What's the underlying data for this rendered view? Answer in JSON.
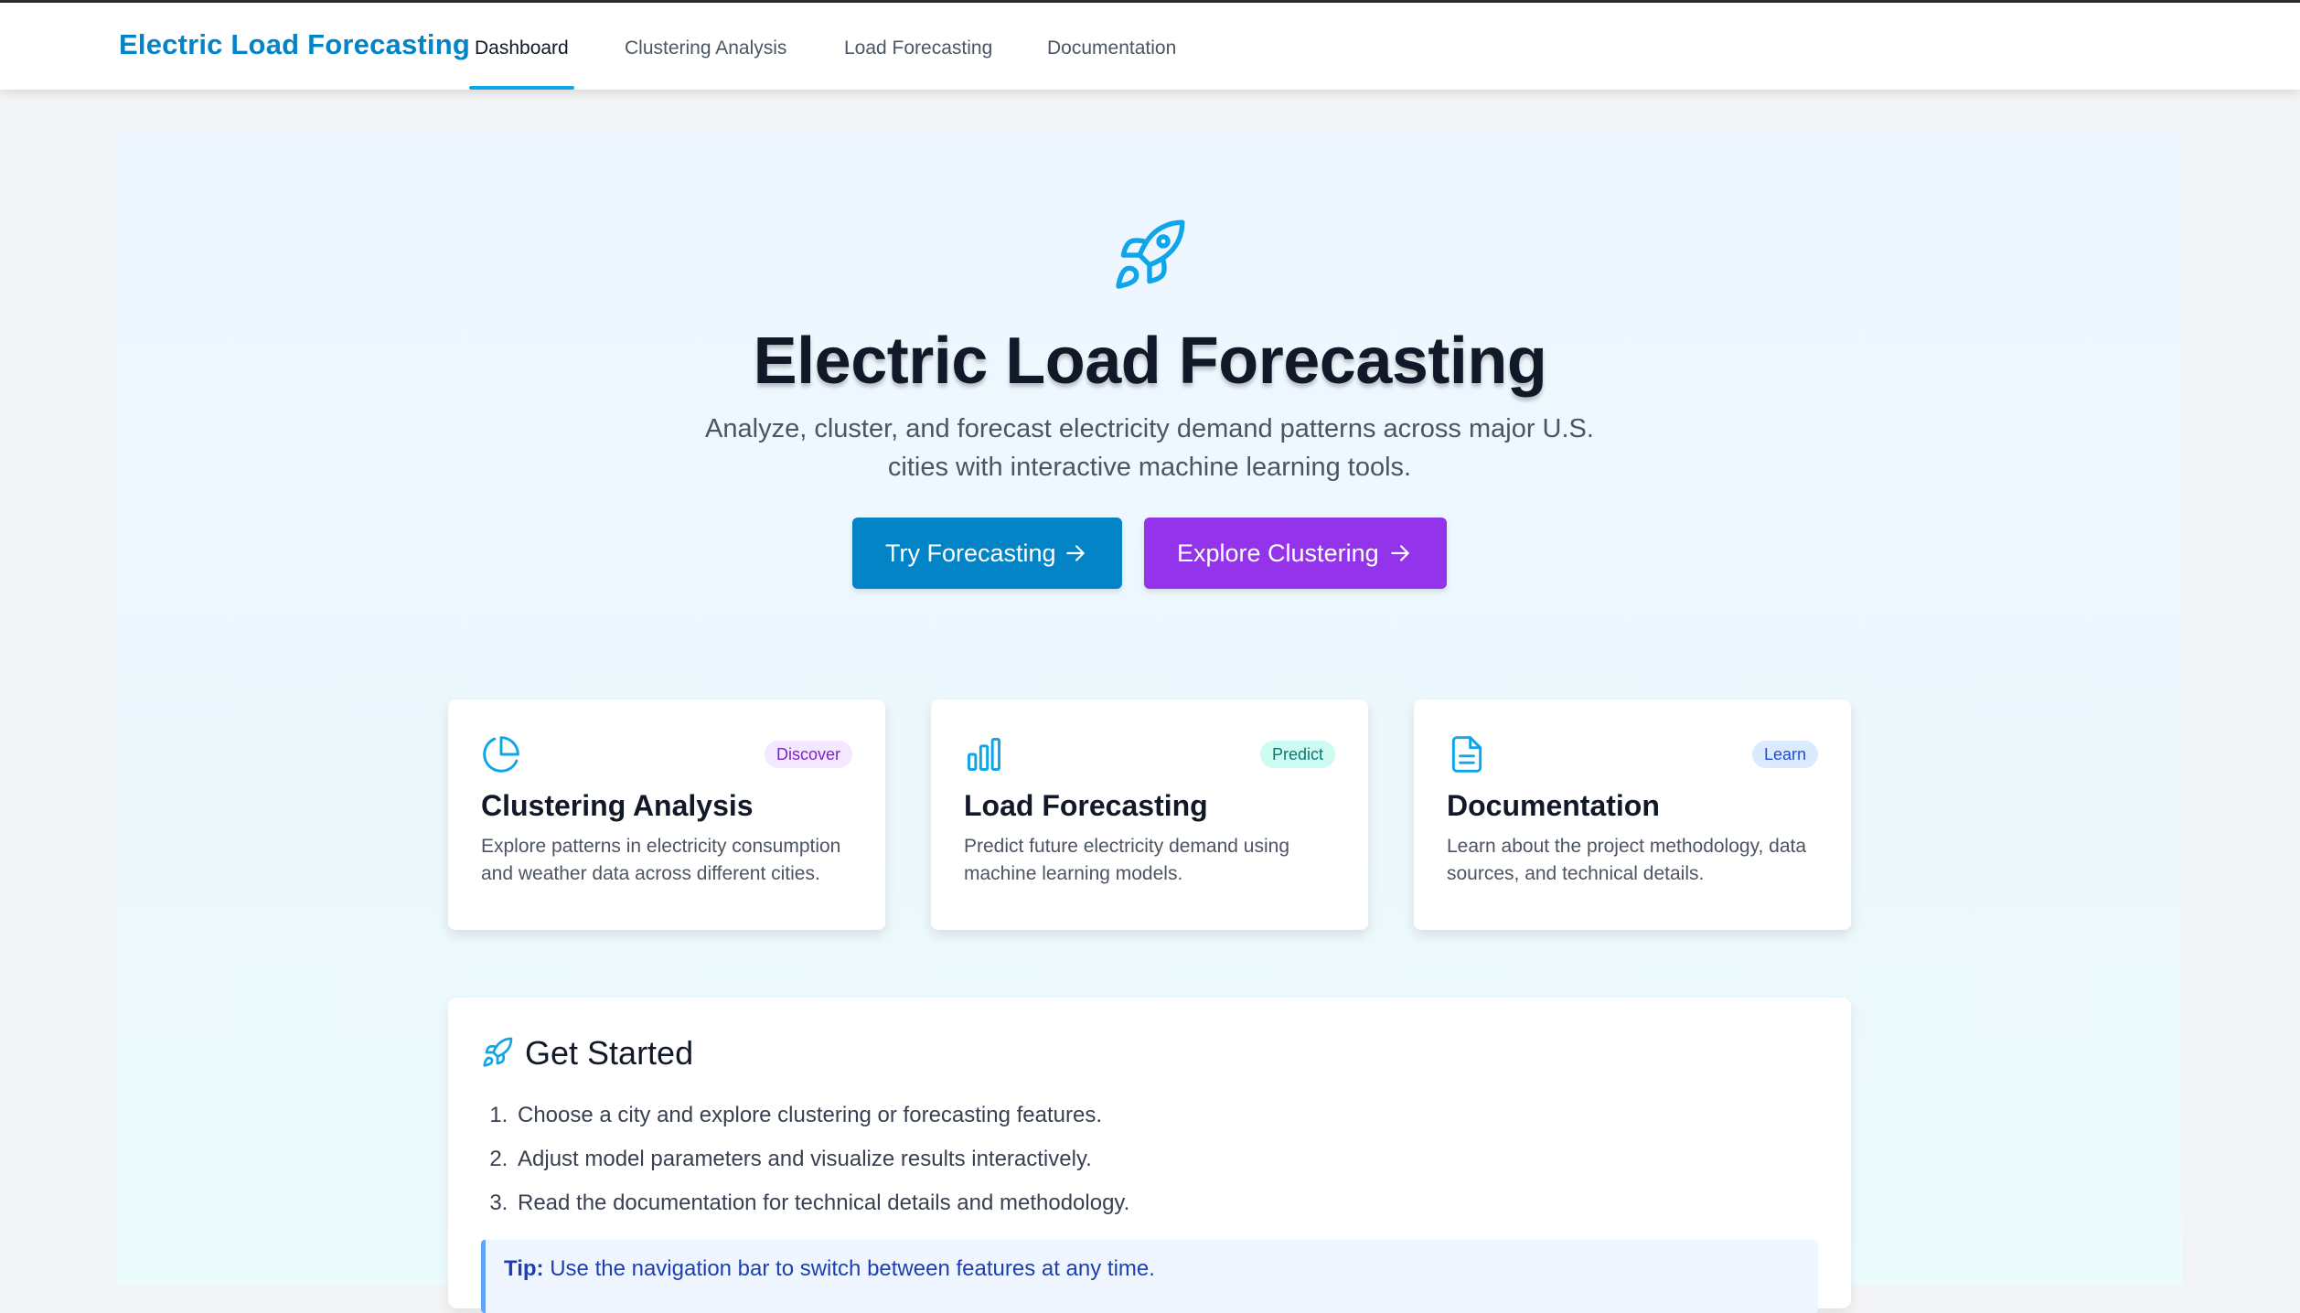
{
  "nav": {
    "brand": "Electric Load Forecasting",
    "links": [
      {
        "label": "Dashboard",
        "active": true
      },
      {
        "label": "Clustering Analysis",
        "active": false
      },
      {
        "label": "Load Forecasting",
        "active": false
      },
      {
        "label": "Documentation",
        "active": false
      }
    ]
  },
  "hero": {
    "icon": "rocket-icon",
    "title": "Electric Load Forecasting",
    "subtitle": "Analyze, cluster, and forecast electricity demand patterns across major U.S. cities with interactive machine learning tools.",
    "buttons": [
      {
        "label": "Try Forecasting",
        "icon": "arrow-right-icon",
        "color": "#0284c7"
      },
      {
        "label": "Explore Clustering",
        "icon": "arrow-right-icon",
        "color": "#9333ea"
      }
    ]
  },
  "cards": [
    {
      "icon": "pie-chart-icon",
      "badge": "Discover",
      "title": "Clustering Analysis",
      "description": "Explore patterns in electricity consumption and weather data across different cities.",
      "badge_color": "#9333ea"
    },
    {
      "icon": "bar-chart-icon",
      "badge": "Predict",
      "title": "Load Forecasting",
      "description": "Predict future electricity demand using machine learning models.",
      "badge_color": "#0f766e"
    },
    {
      "icon": "file-text-icon",
      "badge": "Learn",
      "title": "Documentation",
      "description": "Learn about the project methodology, data sources, and technical details.",
      "badge_color": "#1d4ed8"
    }
  ],
  "get_started": {
    "icon": "rocket-icon",
    "title": "Get Started",
    "steps": [
      "Choose a city and explore clustering or forecasting features.",
      "Adjust model parameters and visualize results interactively.",
      "Read the documentation for technical details and methodology."
    ],
    "tip_label": "Tip:",
    "tip_text": " Use the navigation bar to switch between features at any time."
  },
  "colors": {
    "accent": "#0284c7",
    "purple": "#9333ea",
    "active_underline": "#0ea5e9"
  }
}
